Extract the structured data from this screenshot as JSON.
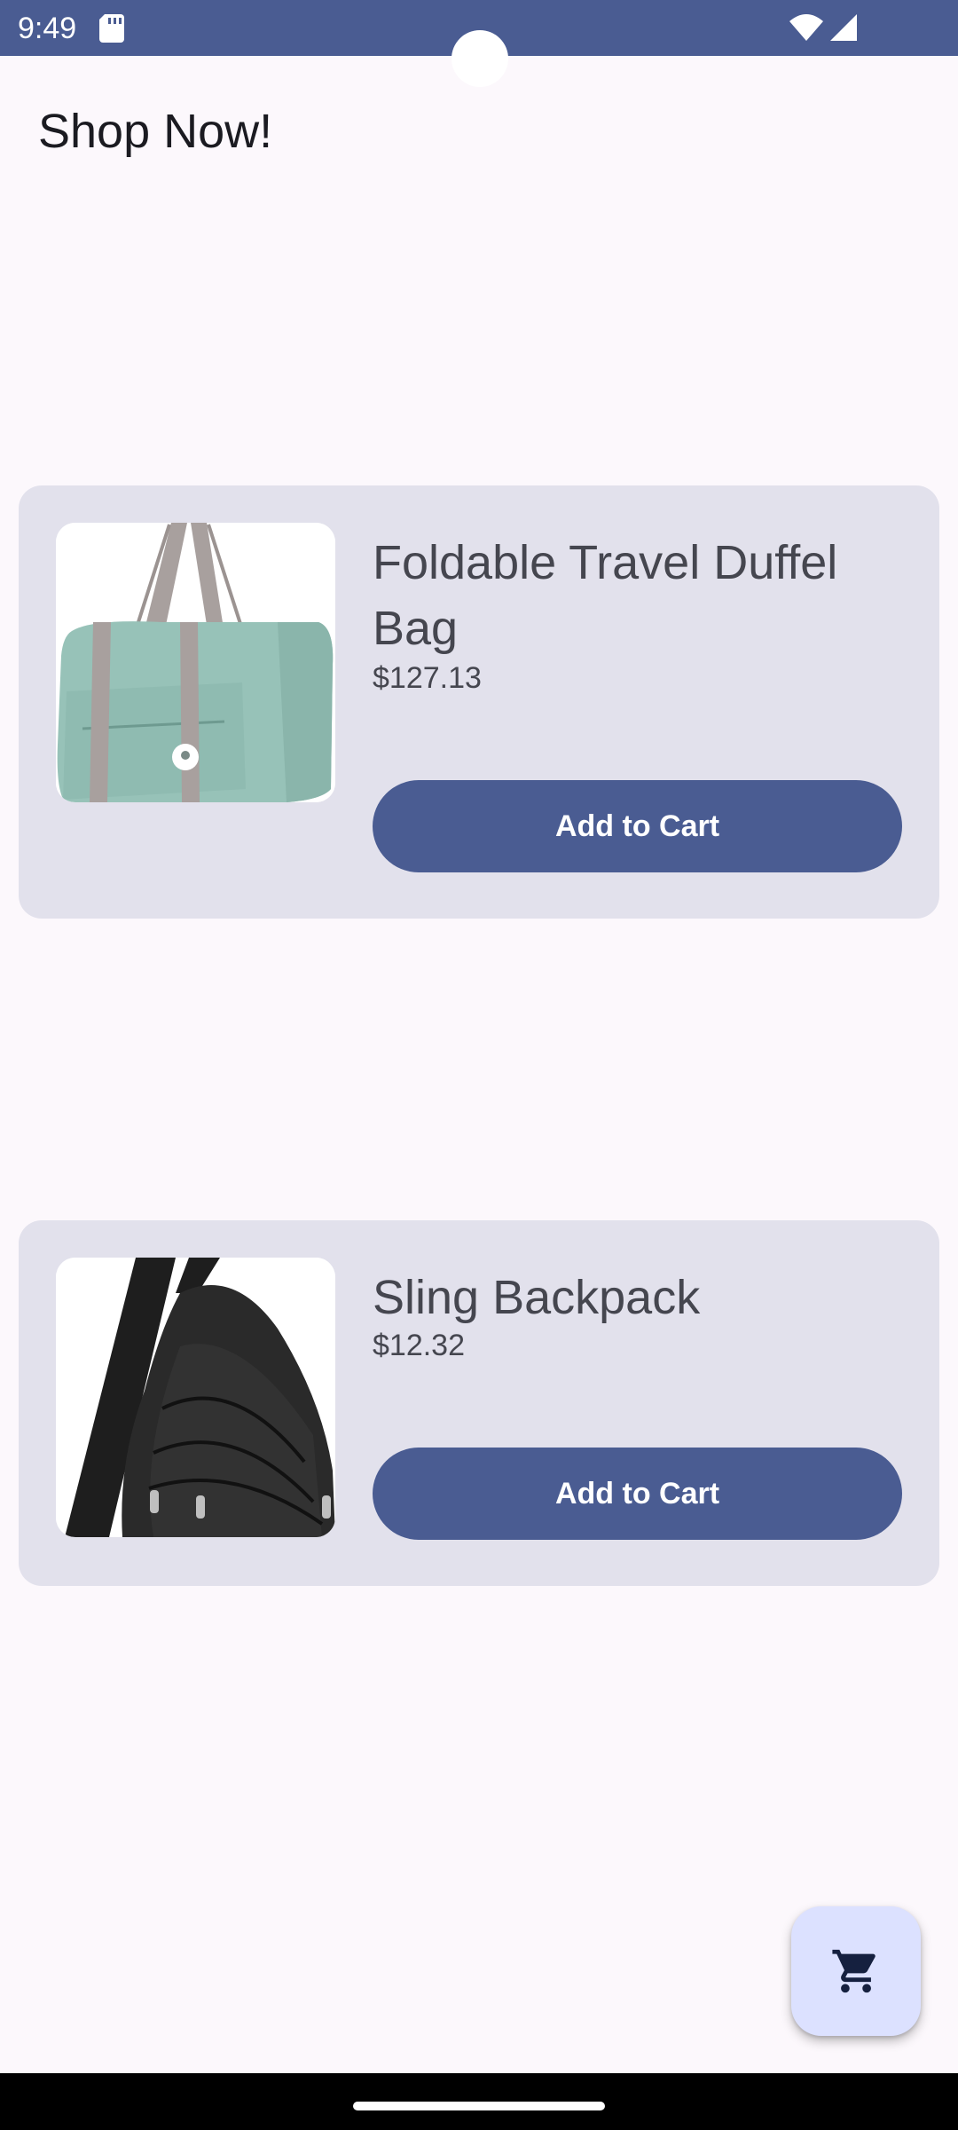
{
  "status_bar": {
    "time": "9:49",
    "icons": [
      "sd-card-icon",
      "wifi-icon",
      "signal-icon"
    ],
    "color": "#4A5C92"
  },
  "header": {
    "title": "Shop Now!"
  },
  "products": [
    {
      "name": "Foldable Travel Duffel Bag",
      "price": "$127.13",
      "button_label": "Add to Cart",
      "image": "mint-duffel-bag"
    },
    {
      "name": "Sling Backpack",
      "price": "$12.32",
      "button_label": "Add to Cart",
      "image": "black-sling-backpack"
    }
  ],
  "fab": {
    "icon": "shopping-cart-icon"
  },
  "colors": {
    "primary": "#4A5C92",
    "card_background": "#E2E1EC",
    "page_background": "#FCF8FC",
    "fab_background": "#DCE1FF"
  }
}
